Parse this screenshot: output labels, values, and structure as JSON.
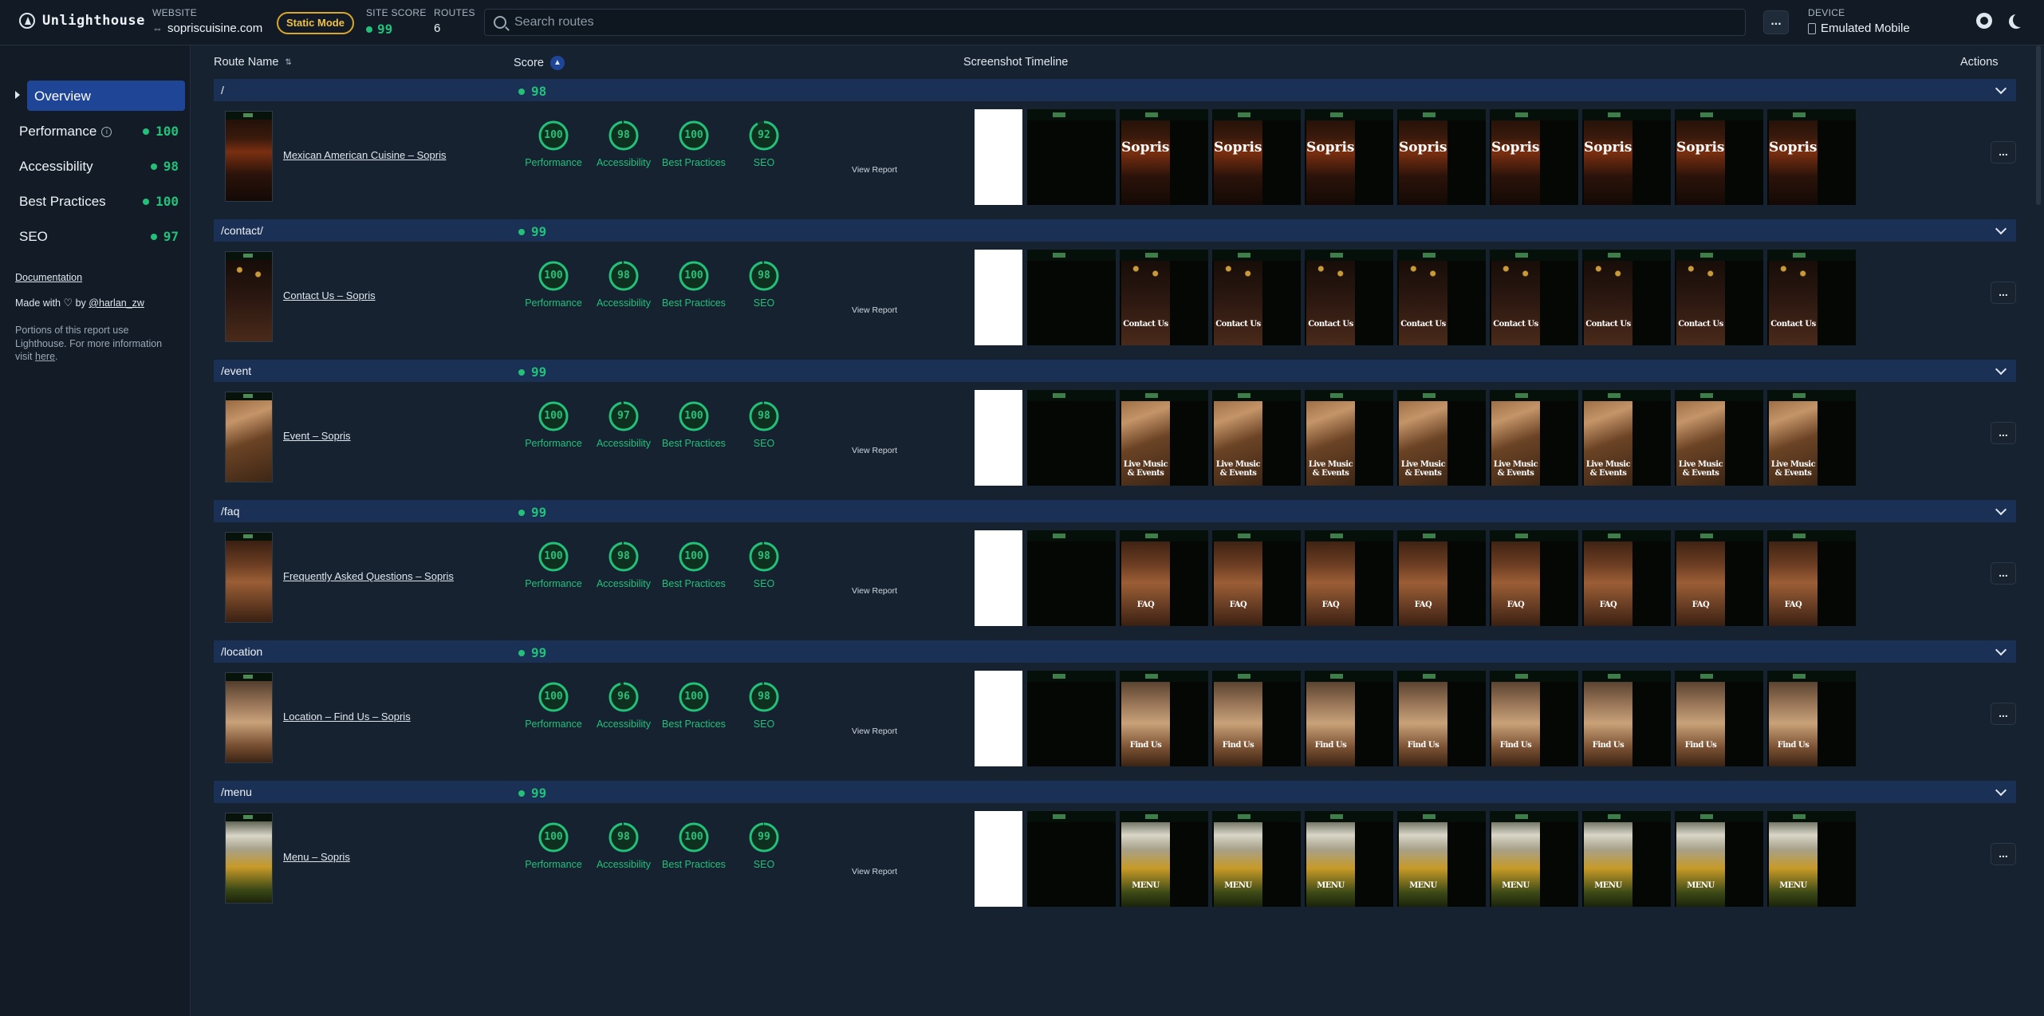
{
  "app": {
    "name": "Unlighthouse"
  },
  "header": {
    "website_label": "WEBSITE",
    "website": "sopriscuisine.com",
    "mode_badge": "Static Mode",
    "site_score_label": "SITE SCORE",
    "site_score": "99",
    "routes_label": "ROUTES",
    "routes_count": "6",
    "search_placeholder": "Search routes",
    "more_label": "...",
    "device_label": "DEVICE",
    "device": "Emulated Mobile",
    "icons": [
      "github-icon",
      "moon-icon"
    ]
  },
  "sidebar": {
    "overview": "Overview",
    "categories": [
      {
        "name": "Performance",
        "score": "100",
        "info": true
      },
      {
        "name": "Accessibility",
        "score": "98",
        "info": false
      },
      {
        "name": "Best Practices",
        "score": "100",
        "info": false
      },
      {
        "name": "SEO",
        "score": "97",
        "info": false
      }
    ],
    "documentation": "Documentation",
    "made_with": "Made with",
    "by": "by",
    "author": "@harlan_zw",
    "note_text": "Portions of this report use Lighthouse. For more information visit",
    "note_link": "here",
    "note_end": "."
  },
  "table": {
    "col_route": "Route Name",
    "col_score": "Score",
    "col_timeline": "Screenshot Timeline",
    "col_actions": "Actions",
    "view_report": "View Report",
    "gauge_labels": [
      "Performance",
      "Accessibility",
      "Best Practices",
      "SEO"
    ],
    "row_more": "...",
    "routes": [
      {
        "path": "/",
        "score": "98",
        "title": "Mexican American Cuisine – Sopris",
        "scores": [
          100,
          98,
          100,
          92
        ],
        "theme": "hero",
        "caption": "Sopris"
      },
      {
        "path": "/contact/",
        "score": "99",
        "title": "Contact Us – Sopris",
        "scores": [
          100,
          98,
          100,
          98
        ],
        "theme": "contact",
        "caption": "Contact Us"
      },
      {
        "path": "/event",
        "score": "99",
        "title": "Event – Sopris",
        "scores": [
          100,
          97,
          100,
          98
        ],
        "theme": "event",
        "caption": "Live Music & Events"
      },
      {
        "path": "/faq",
        "score": "99",
        "title": "Frequently Asked Questions – Sopris",
        "scores": [
          100,
          98,
          100,
          98
        ],
        "theme": "faq",
        "caption": "FAQ"
      },
      {
        "path": "/location",
        "score": "99",
        "title": "Location – Find Us – Sopris",
        "scores": [
          100,
          96,
          100,
          98
        ],
        "theme": "location",
        "caption": "Find Us"
      },
      {
        "path": "/menu",
        "score": "99",
        "title": "Menu – Sopris",
        "scores": [
          100,
          98,
          100,
          99
        ],
        "theme": "menu",
        "caption": "MENU"
      }
    ]
  },
  "colors": {
    "accent": "#1f4597",
    "score_good": "#23c07a",
    "badge": "#d9a826",
    "background": "#162230"
  }
}
